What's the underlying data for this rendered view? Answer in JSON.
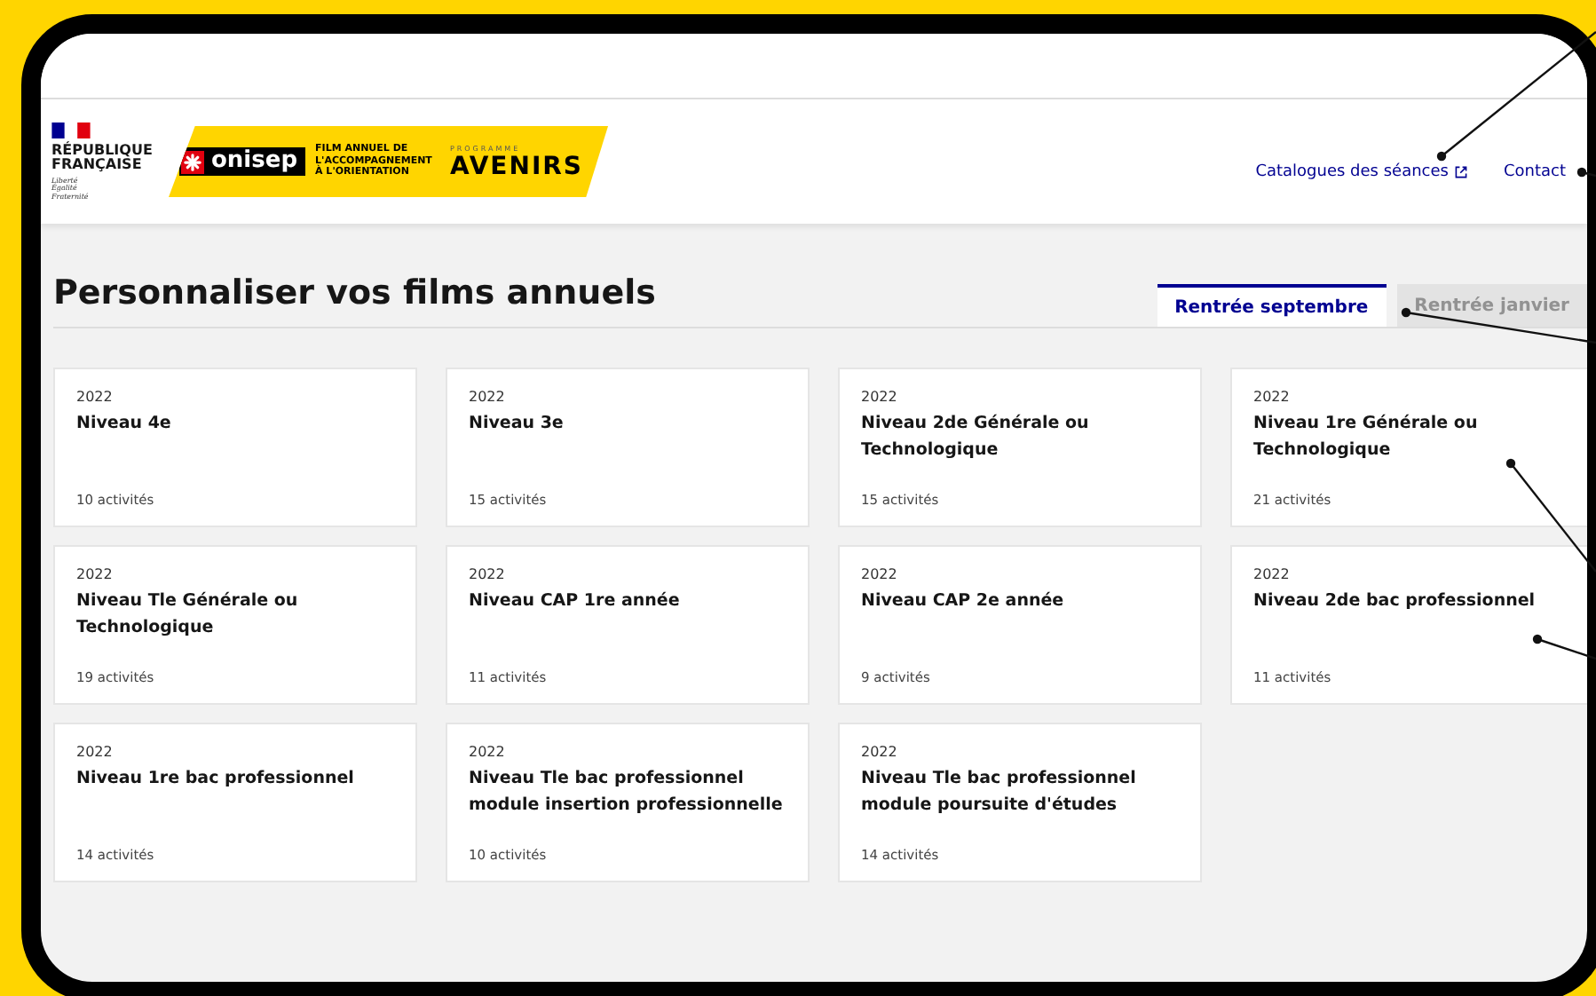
{
  "header": {
    "republic": {
      "lines": [
        "RÉPUBLIQUE",
        "FRANÇAISE"
      ],
      "motto": [
        "Liberté",
        "Égalité",
        "Fraternité"
      ]
    },
    "banner": {
      "brand": "onisep",
      "tagline": [
        "FILM ANNUEL DE",
        "L'ACCOMPAGNEMENT",
        "À L'ORIENTATION"
      ],
      "program_label": "PROGRAMME",
      "program_name": "AVENIRS"
    },
    "nav": [
      {
        "label": "Catalogues des séances",
        "external": true
      },
      {
        "label": "Contact",
        "external": false
      }
    ]
  },
  "page_title": "Personnaliser vos films annuels",
  "tabs": [
    {
      "label": "Rentrée septembre",
      "selected": true
    },
    {
      "label": "Rentrée janvier",
      "selected": false
    }
  ],
  "cards": [
    {
      "year": "2022",
      "title": "Niveau 4e",
      "count": "10 activités"
    },
    {
      "year": "2022",
      "title": "Niveau 3e",
      "count": "15 activités"
    },
    {
      "year": "2022",
      "title": "Niveau 2de Générale ou Technologique",
      "count": "15 activités"
    },
    {
      "year": "2022",
      "title": "Niveau 1re Générale ou Technologique",
      "count": "21 activités"
    },
    {
      "year": "2022",
      "title": "Niveau Tle Générale ou Technologique",
      "count": "19 activités"
    },
    {
      "year": "2022",
      "title": "Niveau CAP 1re année",
      "count": "11 activités"
    },
    {
      "year": "2022",
      "title": "Niveau CAP 2e année",
      "count": "9 activités"
    },
    {
      "year": "2022",
      "title": "Niveau 2de bac professionnel",
      "count": "11 activités"
    },
    {
      "year": "2022",
      "title": "Niveau 1re bac professionnel",
      "count": "14 activités"
    },
    {
      "year": "2022",
      "title": "Niveau Tle bac professionnel module insertion professionnelle",
      "count": "10 activités"
    },
    {
      "year": "2022",
      "title": "Niveau Tle bac professionnel module poursuite d'études",
      "count": "14 activités"
    }
  ]
}
